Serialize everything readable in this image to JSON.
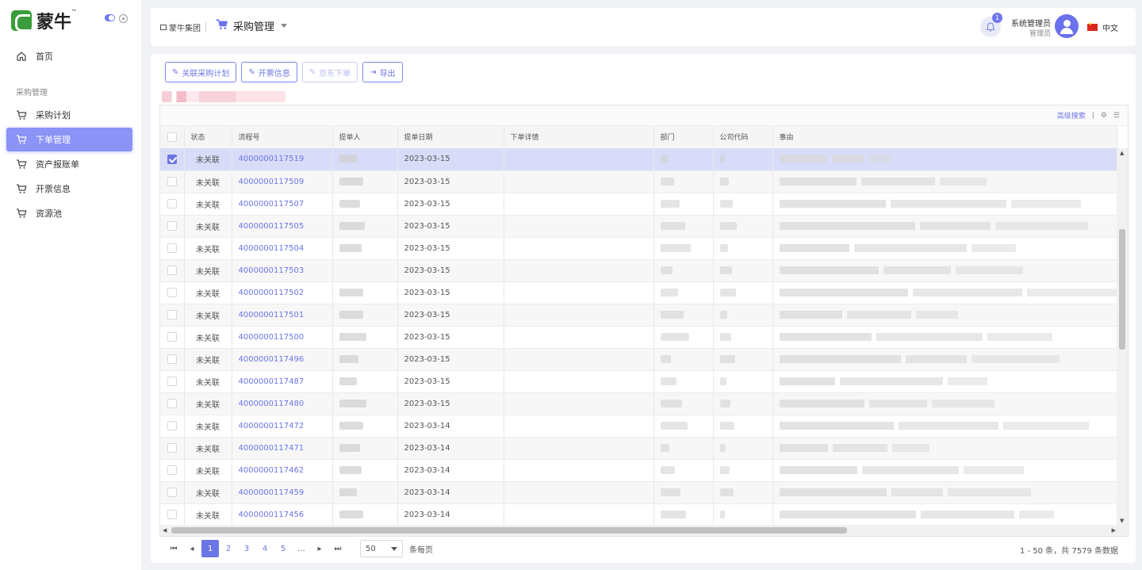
{
  "brand": {
    "logo_text": "蒙牛",
    "tm": "™"
  },
  "sidebar": {
    "home": "首页",
    "group": "采购管理",
    "items": [
      {
        "label": "采购计划"
      },
      {
        "label": "下单管理"
      },
      {
        "label": "资产报账单"
      },
      {
        "label": "开票信息"
      },
      {
        "label": "资源池"
      }
    ]
  },
  "header": {
    "org": "蒙牛集团",
    "module": "采购管理",
    "notifications": "1",
    "user_name": "系统管理员",
    "user_role": "管理员",
    "language": "中文"
  },
  "toolbar": {
    "link_plan": "关联采购计划",
    "invoice": "开票信息",
    "jd_order": "京东下单",
    "export": "导出"
  },
  "grid": {
    "advanced_search": "高级搜索",
    "columns": [
      "状态",
      "流程号",
      "提单人",
      "提单日期",
      "下单详情",
      "部门",
      "公司代码",
      "事由"
    ],
    "rows": [
      {
        "status": "未关联",
        "flow": "4000000117519",
        "date": "2023-03-15",
        "selected": true
      },
      {
        "status": "未关联",
        "flow": "4000000117509",
        "date": "2023-03-15"
      },
      {
        "status": "未关联",
        "flow": "4000000117507",
        "date": "2023-03-15"
      },
      {
        "status": "未关联",
        "flow": "4000000117505",
        "date": "2023-03-15"
      },
      {
        "status": "未关联",
        "flow": "4000000117504",
        "date": "2023-03-15"
      },
      {
        "status": "未关联",
        "flow": "4000000117503",
        "date": "2023-03-15"
      },
      {
        "status": "未关联",
        "flow": "4000000117502",
        "date": "2023-03-15"
      },
      {
        "status": "未关联",
        "flow": "4000000117501",
        "date": "2023-03-15"
      },
      {
        "status": "未关联",
        "flow": "4000000117500",
        "date": "2023-03-15"
      },
      {
        "status": "未关联",
        "flow": "4000000117496",
        "date": "2023-03-15"
      },
      {
        "status": "未关联",
        "flow": "4000000117487",
        "date": "2023-03-15"
      },
      {
        "status": "未关联",
        "flow": "4000000117480",
        "date": "2023-03-15"
      },
      {
        "status": "未关联",
        "flow": "4000000117472",
        "date": "2023-03-14"
      },
      {
        "status": "未关联",
        "flow": "4000000117471",
        "date": "2023-03-14"
      },
      {
        "status": "未关联",
        "flow": "4000000117462",
        "date": "2023-03-14"
      },
      {
        "status": "未关联",
        "flow": "4000000117459",
        "date": "2023-03-14"
      },
      {
        "status": "未关联",
        "flow": "4000000117456",
        "date": "2023-03-14"
      }
    ]
  },
  "pager": {
    "pages": [
      "1",
      "2",
      "3",
      "4",
      "5",
      "..."
    ],
    "page_size": "50",
    "per_page_label": "条每页",
    "total": "1 - 50 条，共 7579 条数据"
  },
  "colors": {
    "accent": "#6c75e6",
    "active_nav": "#8b93f7"
  }
}
